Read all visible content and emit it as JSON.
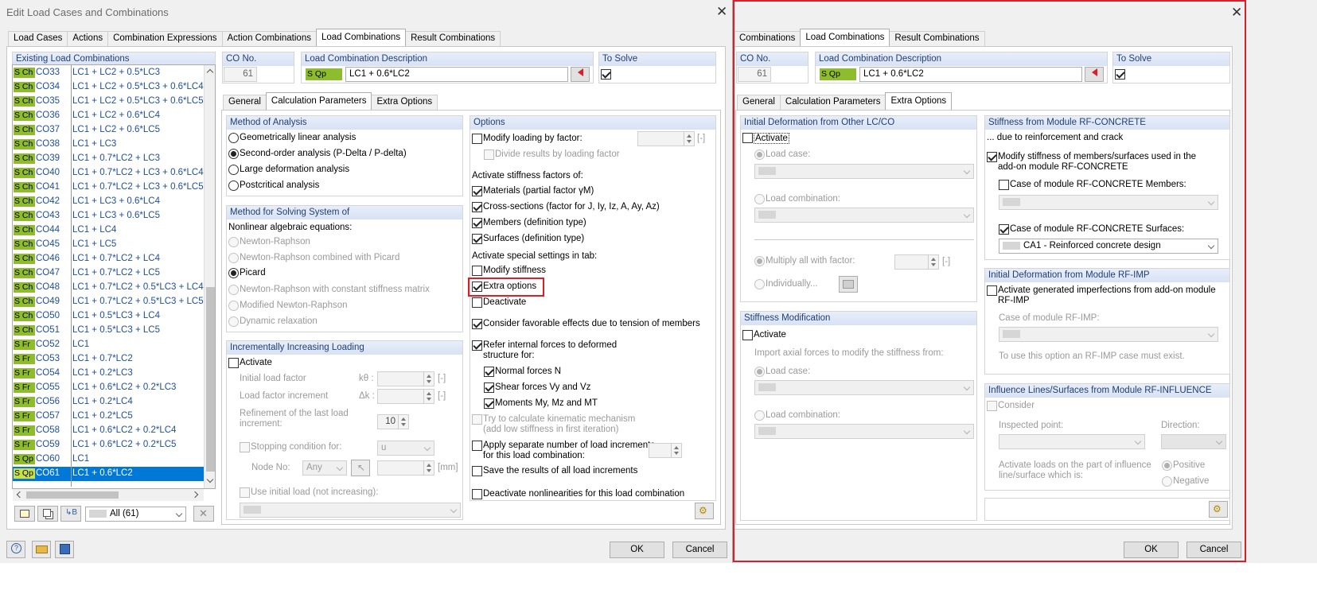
{
  "left": {
    "title": "Edit Load Cases and Combinations",
    "tabs": [
      "Load Cases",
      "Actions",
      "Combination Expressions",
      "Action Combinations",
      "Load Combinations",
      "Result Combinations"
    ],
    "list_header": "Existing Load Combinations",
    "list": [
      {
        "tag": "S Ch",
        "id": "CO33",
        "desc": "LC1 + LC2 + 0.5*LC3"
      },
      {
        "tag": "S Ch",
        "id": "CO34",
        "desc": "LC1 + LC2 + 0.5*LC3 + 0.6*LC4"
      },
      {
        "tag": "S Ch",
        "id": "CO35",
        "desc": "LC1 + LC2 + 0.5*LC3 + 0.6*LC5"
      },
      {
        "tag": "S Ch",
        "id": "CO36",
        "desc": "LC1 + LC2 + 0.6*LC4"
      },
      {
        "tag": "S Ch",
        "id": "CO37",
        "desc": "LC1 + LC2 + 0.6*LC5"
      },
      {
        "tag": "S Ch",
        "id": "CO38",
        "desc": "LC1 + LC3"
      },
      {
        "tag": "S Ch",
        "id": "CO39",
        "desc": "LC1 + 0.7*LC2 + LC3"
      },
      {
        "tag": "S Ch",
        "id": "CO40",
        "desc": "LC1 + 0.7*LC2 + LC3 + 0.6*LC4"
      },
      {
        "tag": "S Ch",
        "id": "CO41",
        "desc": "LC1 + 0.7*LC2 + LC3 + 0.6*LC5"
      },
      {
        "tag": "S Ch",
        "id": "CO42",
        "desc": "LC1 + LC3 + 0.6*LC4"
      },
      {
        "tag": "S Ch",
        "id": "CO43",
        "desc": "LC1 + LC3 + 0.6*LC5"
      },
      {
        "tag": "S Ch",
        "id": "CO44",
        "desc": "LC1 + LC4"
      },
      {
        "tag": "S Ch",
        "id": "CO45",
        "desc": "LC1 + LC5"
      },
      {
        "tag": "S Ch",
        "id": "CO46",
        "desc": "LC1 + 0.7*LC2 + LC4"
      },
      {
        "tag": "S Ch",
        "id": "CO47",
        "desc": "LC1 + 0.7*LC2 + LC5"
      },
      {
        "tag": "S Ch",
        "id": "CO48",
        "desc": "LC1 + 0.7*LC2 + 0.5*LC3 + LC4"
      },
      {
        "tag": "S Ch",
        "id": "CO49",
        "desc": "LC1 + 0.7*LC2 + 0.5*LC3 + LC5"
      },
      {
        "tag": "S Ch",
        "id": "CO50",
        "desc": "LC1 + 0.5*LC3 + LC4"
      },
      {
        "tag": "S Ch",
        "id": "CO51",
        "desc": "LC1 + 0.5*LC3 + LC5"
      },
      {
        "tag": "S Fr",
        "id": "CO52",
        "desc": "LC1"
      },
      {
        "tag": "S Fr",
        "id": "CO53",
        "desc": "LC1 + 0.7*LC2"
      },
      {
        "tag": "S Fr",
        "id": "CO54",
        "desc": "LC1 + 0.2*LC3"
      },
      {
        "tag": "S Fr",
        "id": "CO55",
        "desc": "LC1 + 0.6*LC2 + 0.2*LC3"
      },
      {
        "tag": "S Fr",
        "id": "CO56",
        "desc": "LC1 + 0.2*LC4"
      },
      {
        "tag": "S Fr",
        "id": "CO57",
        "desc": "LC1 + 0.2*LC5"
      },
      {
        "tag": "S Fr",
        "id": "CO58",
        "desc": "LC1 + 0.6*LC2 + 0.2*LC4"
      },
      {
        "tag": "S Fr",
        "id": "CO59",
        "desc": "LC1 + 0.6*LC2 + 0.2*LC5"
      },
      {
        "tag": "S Qp",
        "id": "CO60",
        "desc": "LC1"
      },
      {
        "tag": "S Qp",
        "id": "CO61",
        "desc": "LC1 + 0.6*LC2"
      }
    ],
    "filter": "All (61)",
    "co_no_label": "CO No.",
    "co_no": "61",
    "desc_label": "Load Combination Description",
    "desc_tag": "S Qp",
    "desc_value": "LC1 + 0.6*LC2",
    "to_solve_label": "To Solve",
    "subtabs": [
      "General",
      "Calculation Parameters",
      "Extra Options"
    ],
    "analysis_header": "Method of Analysis",
    "analysis": [
      "Geometrically linear analysis",
      "Second-order analysis (P-Delta / P-delta)",
      "Large deformation analysis",
      "Postcritical analysis"
    ],
    "solving_header": "Method for Solving System of",
    "nonlinear_label": "Nonlinear algebraic equations:",
    "solving": [
      "Newton-Raphson",
      "Newton-Raphson combined with Picard",
      "Picard",
      "Newton-Raphson with constant stiffness matrix",
      "Modified Newton-Raphson",
      "Dynamic relaxation"
    ],
    "incr_header": "Incrementally Increasing Loading",
    "activate": "Activate",
    "initial_load_factor": "Initial load factor",
    "load_factor_increment": "Load factor increment",
    "k0": "kθ :",
    "dk": "Δk :",
    "unit_dash": "[-]",
    "refinement": "Refinement of the last load",
    "increment": "increment:",
    "refine_value": "10",
    "stopping": "Stopping condition for:",
    "stop_value": "u",
    "node_no": "Node No:",
    "node_value": "Any",
    "unit_mm": "[mm]",
    "use_initial": "Use initial load (not increasing):",
    "options_header": "Options",
    "modify_loading": "Modify loading by factor:",
    "divide_results": "Divide results by loading factor",
    "activate_stiffness": "Activate stiffness factors of:",
    "materials": "Materials (partial factor γM)",
    "cross_sections": "Cross-sections (factor for J, Iy, Iz, A, Ay, Az)",
    "members_def": "Members (definition type)",
    "surfaces_def": "Surfaces (definition type)",
    "special_settings": "Activate special settings in tab:",
    "modify_stiffness": "Modify stiffness",
    "extra_options": "Extra options",
    "deactivate": "Deactivate",
    "favorable": "Consider favorable effects due to tension of members",
    "refer_internal": "Refer internal forces to deformed",
    "structure_for": "structure for:",
    "normal_forces": "Normal forces N",
    "shear_forces": "Shear forces Vy and Vz",
    "moments": "Moments My, Mz and MT",
    "kinematic1": "Try to calculate kinematic mechanism",
    "kinematic2": "(add low stiffness in first iteration)",
    "separate1": "Apply separate number of load increments",
    "separate2": "for this load combination:",
    "save_results": "Save the results of all load increments",
    "deactivate_nonlin": "Deactivate nonlinearities for this load combination",
    "ok": "OK",
    "cancel": "Cancel"
  },
  "right": {
    "tabs": [
      "Combinations",
      "Load Combinations",
      "Result Combinations"
    ],
    "co_no_label": "CO No.",
    "co_no": "61",
    "desc_label": "Load Combination Description",
    "desc_tag": "S Qp",
    "desc_value": "LC1 + 0.6*LC2",
    "to_solve_label": "To Solve",
    "subtabs": [
      "General",
      "Calculation Parameters",
      "Extra Options"
    ],
    "initdef_header": "Initial Deformation from Other LC/CO",
    "activate": "Activate",
    "load_case": "Load case:",
    "load_combination": "Load combination:",
    "multiply": "Multiply all with factor:",
    "individually": "Individually...",
    "unit_dash": "[-]",
    "stiffmod_header": "Stiffness Modification",
    "import_axial": "Import axial forces to modify the stiffness from:",
    "rfconcrete_header": "Stiffness from Module RF-CONCRETE",
    "due_to": "... due to reinforcement and crack",
    "modify_members1": "Modify stiffness of members/surfaces used in the",
    "modify_members2": "add-on module RF-CONCRETE",
    "case_members": "Case of module RF-CONCRETE Members:",
    "case_surfaces": "Case of module RF-CONCRETE Surfaces:",
    "surfaces_value": "CA1 - Reinforced concrete design",
    "rfimp_header": "Initial Deformation from Module RF-IMP",
    "activate_imp1": "Activate generated imperfections from add-on module",
    "activate_imp2": "RF-IMP",
    "case_imp": "Case of module RF-IMP:",
    "imp_note": "To use this option an RF-IMP case must exist.",
    "influence_header": "Influence Lines/Surfaces from Module RF-INFLUENCE",
    "consider": "Consider",
    "inspected_point": "Inspected point:",
    "direction": "Direction:",
    "activate_loads1": "Activate loads on the part of influence",
    "activate_loads2": "line/surface which is:",
    "positive": "Positive",
    "negative": "Negative",
    "ok": "OK",
    "cancel": "Cancel"
  },
  "colors": {
    "highlight": "#d9202a",
    "accent": "#0078d7",
    "tag": "#8dbd2f",
    "header_text": "#1f3f76"
  }
}
